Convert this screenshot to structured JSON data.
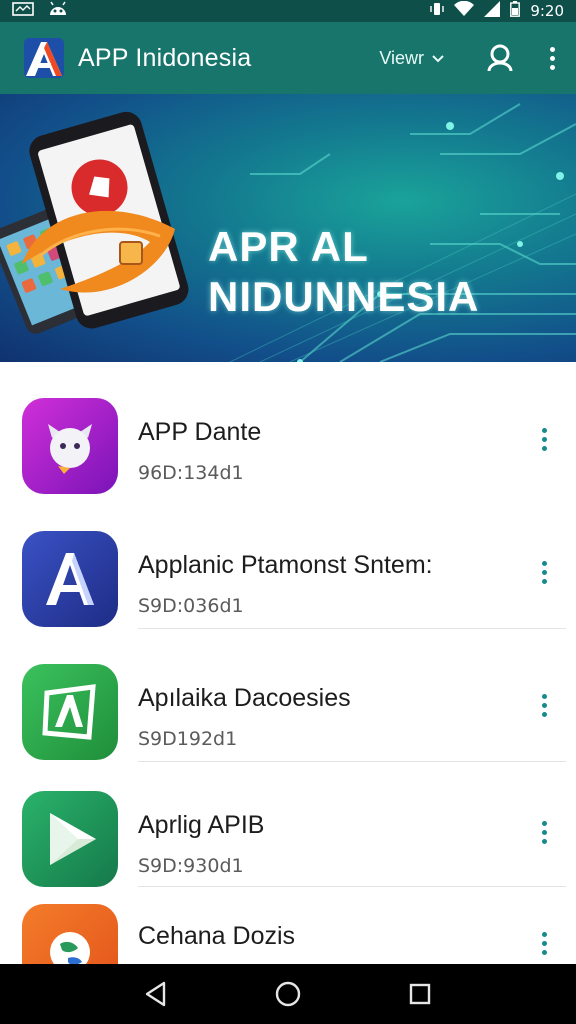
{
  "status_bar": {
    "time": "9:20",
    "icons": [
      "screenshot-icon",
      "android-face-icon",
      "vibrate-icon",
      "wifi-icon",
      "signal-icon",
      "battery-icon"
    ]
  },
  "app_bar": {
    "title": "APP Inidonesia",
    "view_label": "Viewr",
    "logo_icon": "app-logo-icon",
    "search_icon": "user-search-icon",
    "menu_icon": "more-vert-icon"
  },
  "banner": {
    "line1": "APR AL",
    "line2": "NIDUNNESIA"
  },
  "apps": [
    {
      "name": "APP Dante",
      "meta": "96D:134d1",
      "icon": "ghost-face-icon",
      "color": "#b21fc7"
    },
    {
      "name": "Applanic Ptamonst Sntem:",
      "meta": "S9D:036d1",
      "icon": "letter-a-icon",
      "color": "#2d3fa6"
    },
    {
      "name": "Apılaika Dacoesies",
      "meta": "S9D192d1",
      "icon": "letter-a-box-icon",
      "color": "#27a54a"
    },
    {
      "name": "Aprlig APIB",
      "meta": "S9D:930d1",
      "icon": "play-triangle-icon",
      "color": "#1f9a5c"
    },
    {
      "name": "Cehana Dozis",
      "meta": "",
      "icon": "globe-icon",
      "color": "#f26a1d"
    }
  ],
  "nav_bar": {
    "back": "back-triangle-icon",
    "home": "home-circle-icon",
    "recents": "recents-square-icon"
  },
  "colors": {
    "app_bar": "#17756b",
    "status_bar": "#0f4f49",
    "accent": "#178b8c"
  }
}
